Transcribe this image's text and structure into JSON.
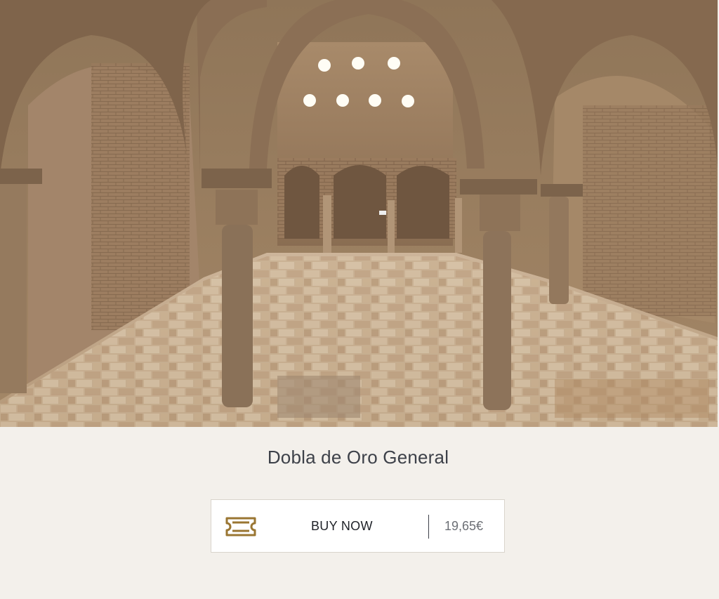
{
  "product": {
    "title": "Dobla de Oro General",
    "buy_label": "BUY NOW",
    "price": "19,65€"
  },
  "hero_image": {
    "subject": "arab-baths-interior",
    "icon": "ticket-icon"
  },
  "colors": {
    "background": "#f3f0eb",
    "accent": "#9a7632",
    "title_text": "#3d4149",
    "price_text": "#6c6f75"
  }
}
